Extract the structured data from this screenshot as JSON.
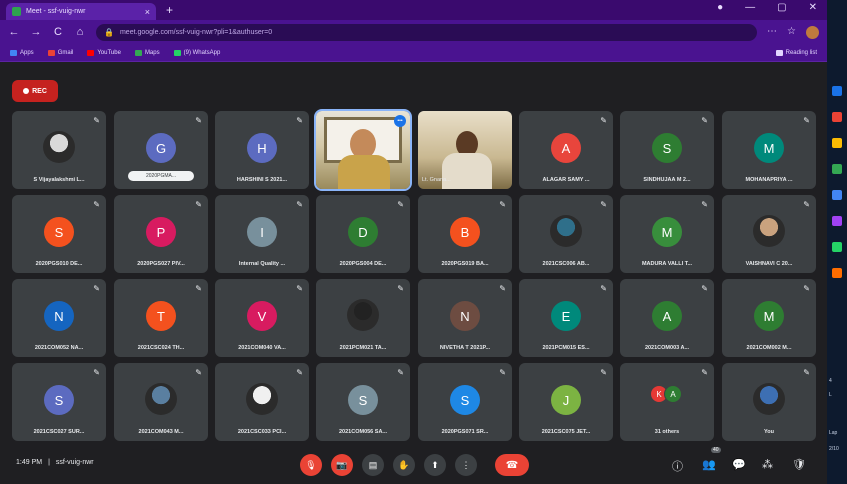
{
  "browser": {
    "tab_title": "Meet - ssf-vuig-nwr",
    "tab_close": "×",
    "new_tab": "+",
    "window_controls": [
      "●",
      "—",
      "▢",
      "✕"
    ],
    "nav": [
      "←",
      "→",
      "C",
      "⌂"
    ],
    "url": "meet.google.com/ssf-vuig-nwr?pli=1&authuser=0",
    "toolbar_icons": [
      "⋯",
      "☆"
    ],
    "bookmarks": [
      {
        "label": "Apps",
        "color": "#4285f4"
      },
      {
        "label": "Gmail",
        "color": "#ea4335"
      },
      {
        "label": "YouTube",
        "color": "#ff0000"
      },
      {
        "label": "Maps",
        "color": "#34a853"
      },
      {
        "label": "(9) WhatsApp",
        "color": "#25d366"
      }
    ],
    "reading_list": "Reading list"
  },
  "meet": {
    "rec_label": "REC",
    "meeting_time": "1:49 PM",
    "separator": "|",
    "meeting_code": "ssf-vuig-nwr",
    "participant_badge": "40",
    "speaking_icon": "•••",
    "tiles": [
      {
        "label": "S Vijayalakshmi L...",
        "initial": "",
        "color": "",
        "kind": "photo",
        "photo_color": "#d9d9d9"
      },
      {
        "label": "2020PGMA...",
        "initial": "G",
        "color": "#5c6bc0",
        "kind": "presenting"
      },
      {
        "label": "HARSHINI S 2021...",
        "initial": "H",
        "color": "#5c6bc0",
        "kind": "initial"
      },
      {
        "label": "",
        "initial": "",
        "color": "",
        "kind": "video1"
      },
      {
        "label": "Lt. Gnana...",
        "initial": "",
        "color": "",
        "kind": "video2"
      },
      {
        "label": "ALAGAR SAMY ...",
        "initial": "A",
        "color": "#e8453c",
        "kind": "initial"
      },
      {
        "label": "SINDHUJAA M 2...",
        "initial": "S",
        "color": "#2e7d32",
        "kind": "initial"
      },
      {
        "label": "MOHANAPRIYA ...",
        "initial": "M",
        "color": "#00897b",
        "kind": "initial"
      },
      {
        "label": "2020PGS010 DE...",
        "initial": "S",
        "color": "#f4511e",
        "kind": "initial"
      },
      {
        "label": "2020PGS027 PIV...",
        "initial": "P",
        "color": "#d81b60",
        "kind": "initial"
      },
      {
        "label": "Internal Quality ...",
        "initial": "I",
        "color": "#78909c",
        "kind": "initial"
      },
      {
        "label": "2020PGS004 DE...",
        "initial": "D",
        "color": "#2e7d32",
        "kind": "initial"
      },
      {
        "label": "2020PGS019 BA...",
        "initial": "B",
        "color": "#f4511e",
        "kind": "initial"
      },
      {
        "label": "2021CSC006 AB...",
        "initial": "",
        "color": "",
        "kind": "photo",
        "photo_color": "#2f6f8a"
      },
      {
        "label": "MADURA VALLI T...",
        "initial": "M",
        "color": "#388e3c",
        "kind": "initial"
      },
      {
        "label": "VAISHNAVI C 20...",
        "initial": "",
        "color": "",
        "kind": "photo",
        "photo_color": "#c9a27e"
      },
      {
        "label": "2021COM052 NA...",
        "initial": "N",
        "color": "#1565c0",
        "kind": "initial"
      },
      {
        "label": "2021CSC024 TH...",
        "initial": "T",
        "color": "#f4511e",
        "kind": "initial"
      },
      {
        "label": "2021COM040 VA...",
        "initial": "V",
        "color": "#d81b60",
        "kind": "initial"
      },
      {
        "label": "2021PCM021 TA...",
        "initial": "",
        "color": "",
        "kind": "photo",
        "photo_color": "#222222"
      },
      {
        "label": "NIVETHA T 2021P...",
        "initial": "N",
        "color": "#6d4c41",
        "kind": "initial"
      },
      {
        "label": "2021PCM015 ES...",
        "initial": "E",
        "color": "#00897b",
        "kind": "initial"
      },
      {
        "label": "2021COM003 A...",
        "initial": "A",
        "color": "#2e7d32",
        "kind": "initial"
      },
      {
        "label": "2021COM002 M...",
        "initial": "M",
        "color": "#2e7d32",
        "kind": "initial"
      },
      {
        "label": "2021CSC027 SUR...",
        "initial": "S",
        "color": "#5c6bc0",
        "kind": "initial"
      },
      {
        "label": "2021COM043 M...",
        "initial": "",
        "color": "",
        "kind": "photo",
        "photo_color": "#5a7fa0"
      },
      {
        "label": "2021CSC033 PCI...",
        "initial": "",
        "color": "",
        "kind": "photo",
        "photo_color": "#f0f0f0"
      },
      {
        "label": "2021COM056 SA...",
        "initial": "S",
        "color": "#78909c",
        "kind": "initial"
      },
      {
        "label": "2020PGS071 SR...",
        "initial": "S",
        "color": "#1e88e5",
        "kind": "initial"
      },
      {
        "label": "2021CSC075 JET...",
        "initial": "J",
        "color": "#7cb342",
        "kind": "initial"
      },
      {
        "label": "31 others",
        "initial": "",
        "color": "",
        "kind": "others"
      },
      {
        "label": "You",
        "initial": "",
        "color": "",
        "kind": "photo",
        "photo_color": "#3d6fb3"
      }
    ],
    "others_avatars": [
      {
        "initial": "K",
        "color": "#e53935"
      },
      {
        "initial": "A",
        "color": "#2e7d32"
      }
    ],
    "controls": [
      {
        "name": "mic-off-button",
        "glyph": "🎙",
        "style": "red"
      },
      {
        "name": "camera-off-button",
        "glyph": "📷",
        "style": "red"
      },
      {
        "name": "captions-button",
        "glyph": "▤",
        "style": "grey"
      },
      {
        "name": "raise-hand-button",
        "glyph": "✋",
        "style": "grey"
      },
      {
        "name": "present-button",
        "glyph": "⬆",
        "style": "grey"
      },
      {
        "name": "more-options-button",
        "glyph": "⋮",
        "style": "grey"
      }
    ],
    "hangup_glyph": "☎",
    "right_icons": [
      {
        "name": "meeting-details-icon",
        "glyph": "ⓘ"
      },
      {
        "name": "people-icon",
        "glyph": "👥"
      },
      {
        "name": "chat-icon",
        "glyph": "💬"
      },
      {
        "name": "activities-icon",
        "glyph": "⁂"
      },
      {
        "name": "host-controls-icon",
        "glyph": "🛡"
      }
    ]
  },
  "dock": {
    "labels": [
      "4",
      "L",
      "Lap",
      "2/10"
    ]
  }
}
